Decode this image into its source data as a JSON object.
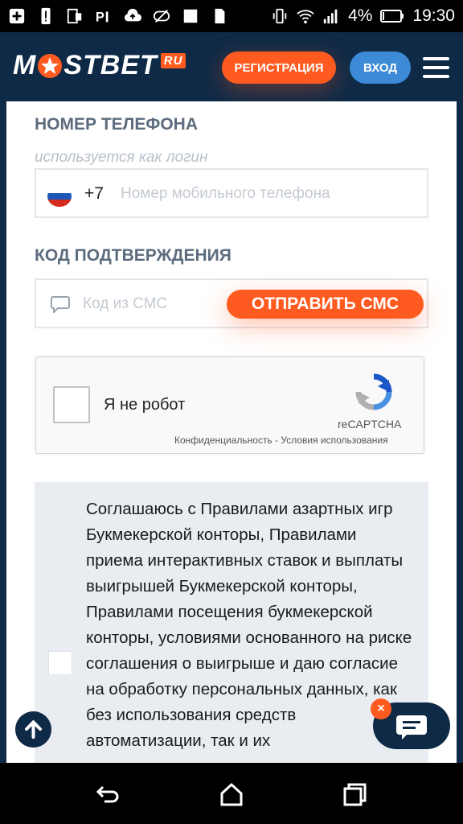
{
  "status_bar": {
    "battery": "4%",
    "time": "19:30"
  },
  "header": {
    "logo_text_left": "M",
    "logo_text_right": "STBET",
    "logo_badge": "RU",
    "register_label": "РЕГИСТРАЦИЯ",
    "login_label": "ВХОД"
  },
  "form": {
    "phone_label": "НОМЕР ТЕЛЕФОНА",
    "phone_hint": "используется как логин",
    "phone_prefix": "+7",
    "phone_placeholder": "Номер мобильного телефона",
    "code_label": "КОД ПОДТВЕРЖДЕНИЯ",
    "code_placeholder": "Код из СМС",
    "send_sms_label": "ОТПРАВИТЬ СМС"
  },
  "captcha": {
    "label": "Я не робот",
    "brand": "reCAPTCHA",
    "links": "Конфиденциальность - Условия использования"
  },
  "agreement": {
    "text": "Соглашаюсь с Правилами азартных игр Букмекерской конторы, Правилами приема интерактивных ставок и выплаты выигрышей Букмекерской конторы, Правилами посещения букмекерской конторы, условиями основанного на риске соглашения о выигрыше и даю согласие на обработку персональных данных, как без использования средств автоматизации, так и их"
  },
  "chat": {
    "close_label": "×"
  },
  "colors": {
    "accent": "#ff5a1f",
    "brand_dark": "#0e2a47",
    "login_blue": "#3d8ad6"
  }
}
